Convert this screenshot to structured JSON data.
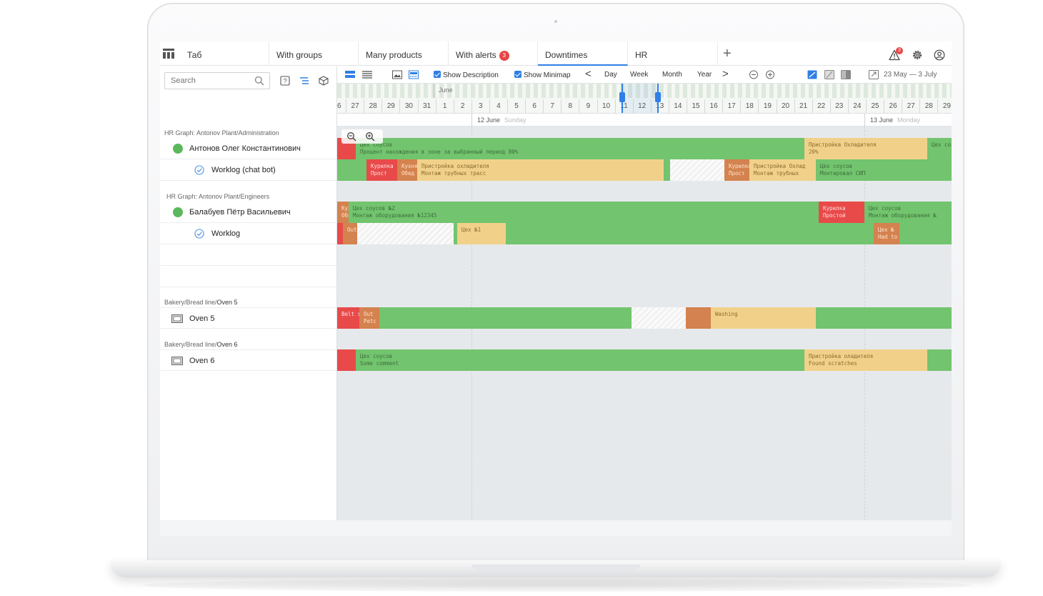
{
  "tabs": [
    {
      "label": "Таб",
      "active": false
    },
    {
      "label": "With groups",
      "active": false
    },
    {
      "label": "Many products",
      "active": false
    },
    {
      "label": "With alerts",
      "badge": "3",
      "active": false
    },
    {
      "label": "Downtimes",
      "active": true
    },
    {
      "label": "HR",
      "active": false
    }
  ],
  "header": {
    "alert_count": "3"
  },
  "left_panel": {
    "search_placeholder": "Search",
    "groups": [
      {
        "label": "HR Graph: Antonov Plant/Administration",
        "rows": [
          {
            "name": "Антонов Олег Константинович",
            "kind": "person"
          },
          {
            "name": "Worklog (chat bot)",
            "kind": "worklog"
          }
        ]
      },
      {
        "label": "HR Graph: Antonov Plant/Engineers",
        "rows": [
          {
            "name": "Балабуев Пётр Васильевич",
            "kind": "person"
          },
          {
            "name": "Worklog",
            "kind": "worklog"
          }
        ]
      },
      {
        "label_prefix": "Bakery/Bread line/",
        "label_bold": "Oven 5",
        "rows": [
          {
            "name": "Oven 5",
            "kind": "oven"
          }
        ]
      },
      {
        "label_prefix": "Bakery/Bread line/",
        "label_bold": "Oven 6",
        "rows": [
          {
            "name": "Oven 6",
            "kind": "oven"
          }
        ]
      }
    ]
  },
  "toolbar": {
    "show_description": "Show Description",
    "show_minimap": "Show Minimap",
    "scales": [
      "Day",
      "Week",
      "Month",
      "Year"
    ],
    "prev": "<",
    "next": ">",
    "date_range": "23 May — 3 July"
  },
  "minimap": {
    "month": "June",
    "days": [
      "26",
      "27",
      "28",
      "29",
      "30",
      "31",
      "1",
      "2",
      "3",
      "4",
      "5",
      "6",
      "7",
      "8",
      "9",
      "10",
      "11",
      "12",
      "13",
      "14",
      "15",
      "16",
      "17",
      "18",
      "19",
      "20",
      "21",
      "22",
      "23",
      "24",
      "25",
      "26",
      "27",
      "28",
      "29"
    ]
  },
  "datebar": [
    {
      "date": "12 June",
      "weekday": "Sunday"
    },
    {
      "date": "13 June",
      "weekday": "Monday"
    }
  ],
  "colors": {
    "running": "#72c46e",
    "setup": "#f1d18a",
    "downtime": "#e84a4a",
    "idle": "#d4824f",
    "accent": "#2f7fe6",
    "alert": "#e84545"
  },
  "gantt": [
    [
      {
        "c": "r",
        "l1": "",
        "l2": ""
      },
      {
        "c": "g",
        "l1": "Цех соусов",
        "l2": "Процент нахождения в зоне за выбранный период 80%"
      },
      {
        "c": "y",
        "l1": "Пристройка Охладителя",
        "l2": "20%"
      },
      {
        "c": "g",
        "l1": "Цех со",
        "l2": ""
      }
    ],
    [
      {
        "c": "g",
        "l1": "",
        "l2": ""
      },
      {
        "c": "r",
        "l1": "Курилка",
        "l2": "Прост"
      },
      {
        "c": "o",
        "l1": "Кухня",
        "l2": "Обед"
      },
      {
        "c": "y",
        "l1": "Пристройка охладителя",
        "l2": "Монтаж трубных трасс"
      },
      {
        "c": "g",
        "l1": "",
        "l2": ""
      },
      {
        "c": "h",
        "l1": "",
        "l2": ""
      },
      {
        "c": "g",
        "l1": "",
        "l2": ""
      },
      {
        "c": "o",
        "l1": "Курилка",
        "l2": "Прост"
      },
      {
        "c": "y",
        "l1": "Пристройка Охлад",
        "l2": "Монтаж трубных"
      },
      {
        "c": "g",
        "l1": "Цех соусов",
        "l2": "Монтировал СИП"
      }
    ],
    [
      {
        "c": "o",
        "l1": "Кухня",
        "l2": "Обед"
      },
      {
        "c": "g",
        "l1": "Цех соусов №2",
        "l2": "Монтаж оборудования №12345"
      },
      {
        "c": "r",
        "l1": "Курилка",
        "l2": "Простой"
      },
      {
        "c": "g",
        "l1": "Цех соусов",
        "l2": "Монтаж оборудования №"
      }
    ],
    [
      {
        "c": "r",
        "l1": "",
        "l2": ""
      },
      {
        "c": "o",
        "l1": "Out",
        "l2": ""
      },
      {
        "c": "h",
        "l1": "",
        "l2": ""
      },
      {
        "c": "g",
        "l1": "",
        "l2": ""
      },
      {
        "c": "y",
        "l1": "Цех №1",
        "l2": ""
      },
      {
        "c": "g",
        "l1": "",
        "l2": ""
      },
      {
        "c": "o",
        "l1": "Цех №",
        "l2": "Had to"
      },
      {
        "c": "g",
        "l1": "",
        "l2": ""
      }
    ],
    [],
    [],
    [
      {
        "c": "r",
        "l1": "Belt st",
        "l2": ""
      },
      {
        "c": "o",
        "l1": "Out",
        "l2": "Petc"
      },
      {
        "c": "g",
        "l1": "",
        "l2": ""
      },
      {
        "c": "h",
        "l1": "",
        "l2": ""
      },
      {
        "c": "o",
        "l1": "",
        "l2": ""
      },
      {
        "c": "y",
        "l1": "Washing",
        "l2": ""
      },
      {
        "c": "g",
        "l1": "",
        "l2": ""
      }
    ],
    [
      {
        "c": "r",
        "l1": "",
        "l2": ""
      },
      {
        "c": "g",
        "l1": "Цех соусов",
        "l2": "Some comment"
      },
      {
        "c": "y",
        "l1": "Пристройка оладителя",
        "l2": "Found scratches"
      },
      {
        "c": "g",
        "l1": "",
        "l2": ""
      }
    ]
  ]
}
